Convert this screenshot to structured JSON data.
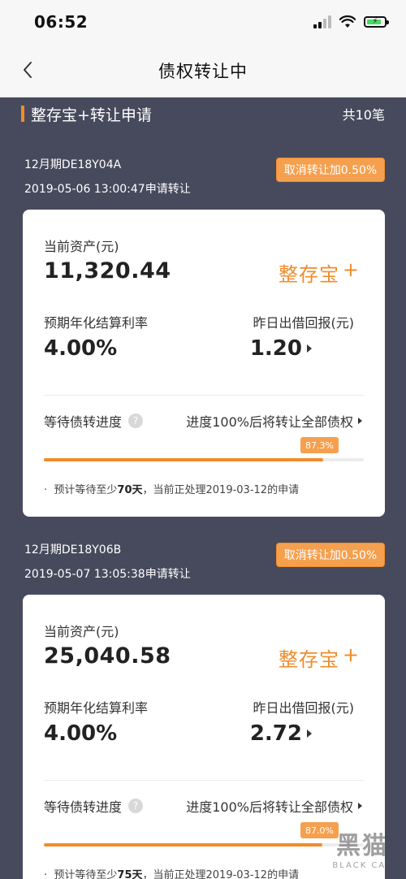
{
  "status_bar": {
    "time": "06:52"
  },
  "nav": {
    "title": "债权转让中",
    "back_icon": "chevron-left-icon"
  },
  "section": {
    "title": "整存宝+转让申请",
    "count": "共10笔"
  },
  "items": [
    {
      "code": "12月期DE18Y04A",
      "date": "2019-05-06 13:00:47申请转让",
      "cancel_label": "取消转让加0.50%",
      "asset_label": "当前资产(元)",
      "asset_value": "11,320.44",
      "product": "整存宝",
      "product_plus": "+",
      "rate_label": "预期年化结算利率",
      "rate_value": "4.00%",
      "yday_label": "昨日出借回报(元)",
      "yday_value": "1.20",
      "progress_label": "等待债转进度",
      "progress_rule": "进度100%后将转让全部债权",
      "progress_pct": "87.3%",
      "progress_value": 0.873,
      "note_prefix": "预计等待至少",
      "note_days": "70天",
      "note_suffix": "，当前正处理2019-03-12的申请"
    },
    {
      "code": "12月期DE18Y06B",
      "date": "2019-05-07 13:05:38申请转让",
      "cancel_label": "取消转让加0.50%",
      "asset_label": "当前资产(元)",
      "asset_value": "25,040.58",
      "product": "整存宝",
      "product_plus": "+",
      "rate_label": "预期年化结算利率",
      "rate_value": "4.00%",
      "yday_label": "昨日出借回报(元)",
      "yday_value": "2.72",
      "progress_label": "等待债转进度",
      "progress_rule": "进度100%后将转让全部债权",
      "progress_pct": "87.0%",
      "progress_value": 0.87,
      "note_prefix": "预计等待至少",
      "note_days": "75天",
      "note_suffix": "，当前正处理2019-03-12的申请"
    }
  ],
  "watermark": {
    "logo": "黑猫",
    "sub": "BLACK CAT"
  },
  "colors": {
    "accent": "#f08c2c",
    "background": "#474a5c"
  }
}
